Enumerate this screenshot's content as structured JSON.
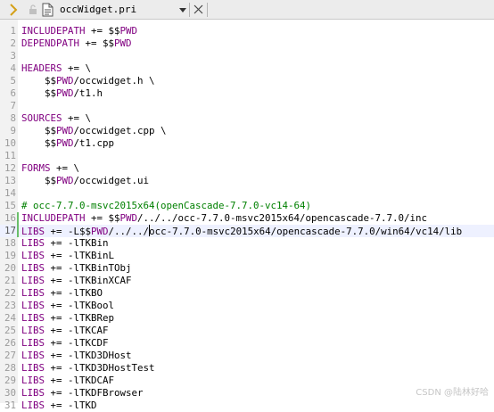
{
  "tab": {
    "filename": "occWidget.pri",
    "dropdown_icon": "caret-down-icon",
    "close_icon": "close-icon"
  },
  "colors": {
    "keyword": "#800080",
    "comment": "#008000",
    "gutter_mark": "#6abf6a"
  },
  "lines": [
    {
      "n": "1",
      "parts": [
        [
          "kw",
          "INCLUDEPATH"
        ],
        [
          "t",
          " += $$"
        ],
        [
          "kw",
          "PWD"
        ]
      ]
    },
    {
      "n": "2",
      "parts": [
        [
          "kw",
          "DEPENDPATH"
        ],
        [
          "t",
          " += $$"
        ],
        [
          "kw",
          "PWD"
        ]
      ]
    },
    {
      "n": "3",
      "parts": []
    },
    {
      "n": "4",
      "parts": [
        [
          "kw",
          "HEADERS"
        ],
        [
          "t",
          " += \\"
        ]
      ]
    },
    {
      "n": "5",
      "parts": [
        [
          "t",
          "    $$"
        ],
        [
          "kw",
          "PWD"
        ],
        [
          "t",
          "/occwidget.h \\"
        ]
      ]
    },
    {
      "n": "6",
      "parts": [
        [
          "t",
          "    $$"
        ],
        [
          "kw",
          "PWD"
        ],
        [
          "t",
          "/t1.h"
        ]
      ]
    },
    {
      "n": "7",
      "parts": []
    },
    {
      "n": "8",
      "parts": [
        [
          "kw",
          "SOURCES"
        ],
        [
          "t",
          " += \\"
        ]
      ]
    },
    {
      "n": "9",
      "parts": [
        [
          "t",
          "    $$"
        ],
        [
          "kw",
          "PWD"
        ],
        [
          "t",
          "/occwidget.cpp \\"
        ]
      ]
    },
    {
      "n": "10",
      "parts": [
        [
          "t",
          "    $$"
        ],
        [
          "kw",
          "PWD"
        ],
        [
          "t",
          "/t1.cpp"
        ]
      ]
    },
    {
      "n": "11",
      "parts": []
    },
    {
      "n": "12",
      "parts": [
        [
          "kw",
          "FORMS"
        ],
        [
          "t",
          " += \\"
        ]
      ]
    },
    {
      "n": "13",
      "parts": [
        [
          "t",
          "    $$"
        ],
        [
          "kw",
          "PWD"
        ],
        [
          "t",
          "/occwidget.ui"
        ]
      ]
    },
    {
      "n": "14",
      "parts": []
    },
    {
      "n": "15",
      "parts": [
        [
          "cm",
          "# occ-7.7.0-msvc2015x64(openCascade-7.7.0-vc14-64)"
        ]
      ]
    },
    {
      "n": "16",
      "mark": true,
      "parts": [
        [
          "kw",
          "INCLUDEPATH"
        ],
        [
          "t",
          " += $$"
        ],
        [
          "kw",
          "PWD"
        ],
        [
          "t",
          "/../../occ-7.7.0-msvc2015x64/opencascade-7.7.0/inc"
        ]
      ]
    },
    {
      "n": "17",
      "mark": true,
      "current": true,
      "parts": [
        [
          "kw",
          "LIBS"
        ],
        [
          "t",
          " += -L$$"
        ],
        [
          "kw",
          "PWD"
        ],
        [
          "t",
          "/../../"
        ],
        [
          "caret",
          ""
        ],
        [
          "t",
          "occ-7.7.0-msvc2015x64/opencascade-7.7.0/win64/vc14/lib"
        ]
      ]
    },
    {
      "n": "18",
      "parts": [
        [
          "kw",
          "LIBS"
        ],
        [
          "t",
          " += -lTKBin"
        ]
      ]
    },
    {
      "n": "19",
      "parts": [
        [
          "kw",
          "LIBS"
        ],
        [
          "t",
          " += -lTKBinL"
        ]
      ]
    },
    {
      "n": "20",
      "parts": [
        [
          "kw",
          "LIBS"
        ],
        [
          "t",
          " += -lTKBinTObj"
        ]
      ]
    },
    {
      "n": "21",
      "parts": [
        [
          "kw",
          "LIBS"
        ],
        [
          "t",
          " += -lTKBinXCAF"
        ]
      ]
    },
    {
      "n": "22",
      "parts": [
        [
          "kw",
          "LIBS"
        ],
        [
          "t",
          " += -lTKBO"
        ]
      ]
    },
    {
      "n": "23",
      "parts": [
        [
          "kw",
          "LIBS"
        ],
        [
          "t",
          " += -lTKBool"
        ]
      ]
    },
    {
      "n": "24",
      "parts": [
        [
          "kw",
          "LIBS"
        ],
        [
          "t",
          " += -lTKBRep"
        ]
      ]
    },
    {
      "n": "25",
      "parts": [
        [
          "kw",
          "LIBS"
        ],
        [
          "t",
          " += -lTKCAF"
        ]
      ]
    },
    {
      "n": "26",
      "parts": [
        [
          "kw",
          "LIBS"
        ],
        [
          "t",
          " += -lTKCDF"
        ]
      ]
    },
    {
      "n": "27",
      "parts": [
        [
          "kw",
          "LIBS"
        ],
        [
          "t",
          " += -lTKD3DHost"
        ]
      ]
    },
    {
      "n": "28",
      "parts": [
        [
          "kw",
          "LIBS"
        ],
        [
          "t",
          " += -lTKD3DHostTest"
        ]
      ]
    },
    {
      "n": "29",
      "parts": [
        [
          "kw",
          "LIBS"
        ],
        [
          "t",
          " += -lTKDCAF"
        ]
      ]
    },
    {
      "n": "30",
      "parts": [
        [
          "kw",
          "LIBS"
        ],
        [
          "t",
          " += -lTKDFBrowser"
        ]
      ]
    },
    {
      "n": "31",
      "parts": [
        [
          "kw",
          "LIBS"
        ],
        [
          "t",
          " += -lTKD"
        ]
      ]
    }
  ],
  "watermark": "CSDN @陆林好哈"
}
